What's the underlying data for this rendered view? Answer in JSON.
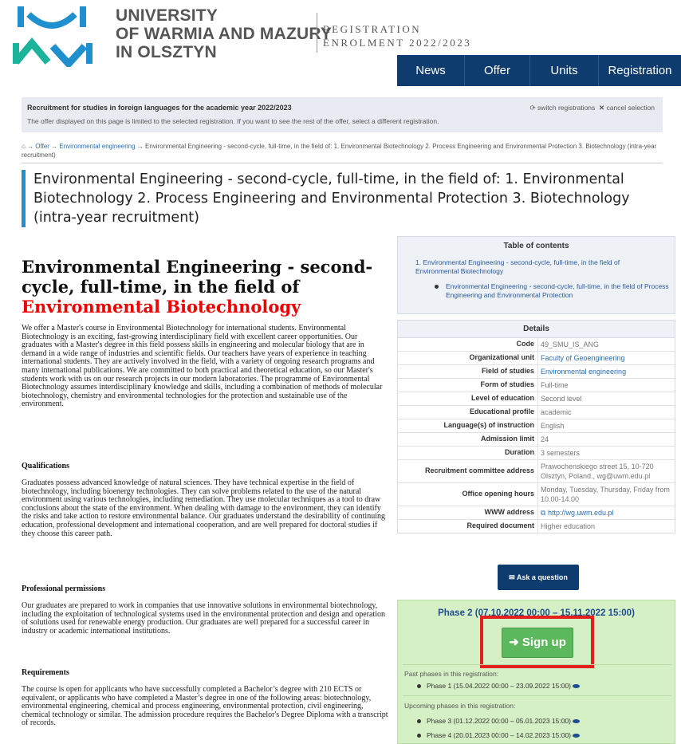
{
  "header": {
    "university_lines": [
      "UNIVERSITY",
      "OF WARMIA AND MAZURY",
      "IN OLSZTYN"
    ],
    "reg_lines": [
      "REGISTRATION",
      "ENROLMENT 2022/2023"
    ],
    "nav": [
      "News",
      "Offer",
      "Units",
      "Registration"
    ],
    "colors": {
      "navy": "#0e3c6e",
      "green_logo": "#1bb39a",
      "blue_logo": "#1f8fce"
    }
  },
  "recruitment": {
    "title": "Recruitment for studies in foreign languages for the academic year 2022/2023",
    "note": "The offer displayed on this page is limited to the selected registration. If you want to see the rest of the offer, select a different registration.",
    "switch_label": "switch registrations",
    "cancel_label": "cancel selection"
  },
  "breadcrumb": {
    "offer": "Offer",
    "field": "Environmental engineering",
    "current": "Environmental Engineering - second-cycle, full-time, in the field of: 1. Environmental Biotechnology 2. Process Engineering and Environmental Protection 3. Biotechnology (intra-year recruitment)"
  },
  "page_title": "Environmental Engineering - second-cycle, full-time, in the field of: 1. Environmental Biotechnology 2. Process Engineering and Environmental Protection 3. Biotechnology (intra-year recruitment)",
  "article": {
    "heading_black": "Environmental Engineering - second-cycle, full-time, in the field of",
    "heading_red": "Environmental Biotechnology",
    "intro": "We offer a Master's course in Environmental Biotechnology for international students. Environmental Biotechnology is an exciting, fast-growing interdisciplinary field with excellent career opportunities. Our graduates with a Master's degree in this field possess skills in engineering and molecular biology that are in demand in a wide range of industries and scientific fields. Our teachers have years of experience in teaching international students. They are actively involved in the field, with a variety of ongoing research programs and many international publications. We are committed to both practical and theoretical education, so our Master's students work with us on our research projects in our modern laboratories. The programme of Environmental Biotechnology assumes interdisciplinary knowledge and skills, including a combination of methods of molecular biotechnology, chemistry and environmental technologies for the protection and sustainable use of the environment.",
    "qual_h": "Qualifications",
    "qual": "Graduates possess advanced knowledge of natural sciences. They have technical expertise in the field of biotechnology, including bioenergy technologies. They can solve problems related to the use of the natural environment using various technologies, including remediation. They use molecular techniques as a tool to draw conclusions about the state of the environment. When dealing with damage to the environment, they can identify the risks and take action to restore environmental balance. Our graduates understand the desirability of continuing education, professional development and international cooperation, and are well prepared for doctoral studies if they choose this career path.",
    "perm_h": "Professional permissions",
    "perm": "Our graduates are prepared to work in companies that use innovative solutions in environmental biotechnology, including the exploitation of technological systems used in the environmental protection and design and operation of solutions used for renewable energy production. Our graduates are well prepared for a successful career in industry or academic international institutions.",
    "req_h": "Requirements",
    "req": "The course is open for applicants who have successfully completed a Bachelor’s degree with 210 ECTS or equivalent, or applicants who have completed a Master’s degree in one of the following areas: biotechnology, environmental engineering, chemical and process engineering, environmental protection, civil engineering, chemical technology or similar. The admission procedure requires the Bachelor's Degree Diploma with a transcript of records."
  },
  "toc": {
    "title": "Table of contents",
    "item1": "1. Environmental Engineering - second-cycle, full-time, in the field of Environmental Biotechnology",
    "item2": "Environmental Engineering - second-cycle, full-time, in the field of Process Engineering and Environmental Protection"
  },
  "details": {
    "title": "Details",
    "rows": [
      {
        "k": "Code",
        "v": "49_SMU_IS_ANG"
      },
      {
        "k": "Organizational unit",
        "v": "Faculty of Geoengineering"
      },
      {
        "k": "Field of studies",
        "v": "Environmental engineering"
      },
      {
        "k": "Form of studies",
        "v": "Full-time"
      },
      {
        "k": "Level of education",
        "v": "Second level"
      },
      {
        "k": "Educational profile",
        "v": "academic"
      },
      {
        "k": "Language(s) of instruction",
        "v": "English"
      },
      {
        "k": "Admission limit",
        "v": "24"
      },
      {
        "k": "Duration",
        "v": "3 semesters"
      },
      {
        "k": "Recruitment committee address",
        "v": "Prawochenskiego street 15, 10-720 Olsztyn, Poland., wg@uwm.edu.pl"
      },
      {
        "k": "Office opening hours",
        "v": "Monday, Tuesday, Thursday, Friday from 10.00-14.00"
      },
      {
        "k": "WWW address",
        "v": "http://wg.uwm.edu.pl"
      },
      {
        "k": "Required document",
        "v": "Higher education"
      }
    ],
    "ask_label": "Ask a question"
  },
  "phase": {
    "title": "Phase 2 (07.10.2022 00:00 – 15.11.2022 15:00)",
    "signup": "Sign up",
    "past_label": "Past phases in this registration:",
    "past": [
      "Phase 1 (15.04.2022 00:00 – 23.09.2022 15:00)"
    ],
    "upcoming_label": "Upcoming phases in this registration:",
    "upcoming": [
      "Phase 3 (01.12.2022 00:00 – 05.01.2023 15:00)",
      "Phase 4 (20.01.2023 00:00 – 14.02.2023 15:00)"
    ],
    "highlight_color": "#e3201b"
  }
}
